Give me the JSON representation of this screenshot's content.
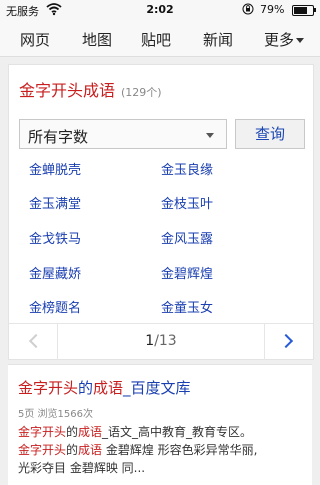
{
  "status_bar": {
    "carrier": "无服务",
    "time": "2:02",
    "battery_pct": "79%",
    "battery_level": 0.79,
    "wifi_icon": "wifi-icon",
    "lock_icon": "orientation-lock-icon"
  },
  "nav": {
    "items": [
      {
        "label": "网页"
      },
      {
        "label": "地图"
      },
      {
        "label": "贴吧"
      },
      {
        "label": "新闻"
      },
      {
        "label": "更多"
      }
    ]
  },
  "idiom_card": {
    "title": "金字开头成语",
    "count": "(129个)",
    "select_value": "所有字数",
    "query_label": "查询",
    "words": [
      "金蝉脱壳",
      "金玉良缘",
      "金玉满堂",
      "金枝玉叶",
      "金戈铁马",
      "金风玉露",
      "金屋藏娇",
      "金碧辉煌",
      "金榜题名",
      "金童玉女"
    ],
    "page_current": "1",
    "page_total": "/13"
  },
  "result": {
    "title_parts": [
      "金字开头",
      "的",
      "成语",
      "_百度文库"
    ],
    "meta": "5页 浏览1566次",
    "line1_parts": [
      "金字开头",
      "的",
      "成语",
      "_语文_高中教育_教育专区。"
    ],
    "line2_parts": [
      "金字开头",
      "的",
      "成语",
      " 金碧辉煌 形容色彩异常华丽,"
    ],
    "line3": "光彩夺目 金碧辉映 同..."
  },
  "colors": {
    "link_blue": "#1a3fb0",
    "highlight_red": "#c81e1e"
  }
}
